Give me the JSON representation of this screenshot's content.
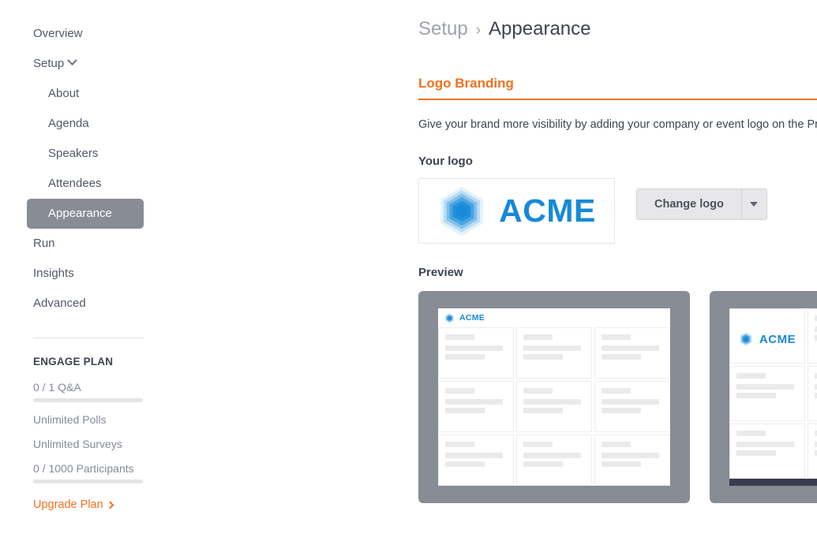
{
  "sidebar": {
    "items": [
      {
        "label": "Overview",
        "level": "top",
        "active": false,
        "expandable": false
      },
      {
        "label": "Setup",
        "level": "top",
        "active": false,
        "expandable": true
      },
      {
        "label": "About",
        "level": "sub",
        "active": false,
        "expandable": false
      },
      {
        "label": "Agenda",
        "level": "sub",
        "active": false,
        "expandable": false
      },
      {
        "label": "Speakers",
        "level": "sub",
        "active": false,
        "expandable": false
      },
      {
        "label": "Attendees",
        "level": "sub",
        "active": false,
        "expandable": false
      },
      {
        "label": "Appearance",
        "level": "sub",
        "active": true,
        "expandable": false
      },
      {
        "label": "Run",
        "level": "top",
        "active": false,
        "expandable": false
      },
      {
        "label": "Insights",
        "level": "top",
        "active": false,
        "expandable": false
      },
      {
        "label": "Advanced",
        "level": "top",
        "active": false,
        "expandable": false
      }
    ],
    "plan": {
      "title": "ENGAGE PLAN",
      "rows": [
        {
          "label": "0 / 1 Q&A",
          "bar": true,
          "fill_percent": 0
        },
        {
          "label": "Unlimited Polls",
          "bar": false
        },
        {
          "label": "Unlimited Surveys",
          "bar": false
        },
        {
          "label": "0 / 1000 Participants",
          "bar": true,
          "fill_percent": 0
        }
      ],
      "upgrade_label": "Upgrade Plan"
    }
  },
  "breadcrumb": {
    "parent": "Setup",
    "separator": "›",
    "current": "Appearance"
  },
  "section": {
    "title": "Logo Branding",
    "description": "Give your brand more visibility by adding your company or event logo on the Projector Panel.",
    "your_logo_label": "Your logo",
    "preview_label": "Preview"
  },
  "logo": {
    "wordmark": "ACME",
    "mark_color": "#1789d8",
    "wordmark_color": "#1789d8"
  },
  "buttons": {
    "change_logo": "Change logo",
    "dropdown_caret": "caret-down-icon"
  },
  "previews": [
    {
      "name": "logo-in-header",
      "logo_position": "header",
      "cells": 9,
      "has_footer_bar": false
    },
    {
      "name": "logo-in-first-card",
      "logo_position": "first-cell",
      "cells": 9,
      "has_footer_bar": true
    }
  ],
  "colors": {
    "accent_orange": "#f2701d",
    "active_nav": "#878c95",
    "preview_frame": "#878c95",
    "footer_bar": "#373d4d",
    "text": "#3d4450",
    "muted_text": "#858a93"
  }
}
